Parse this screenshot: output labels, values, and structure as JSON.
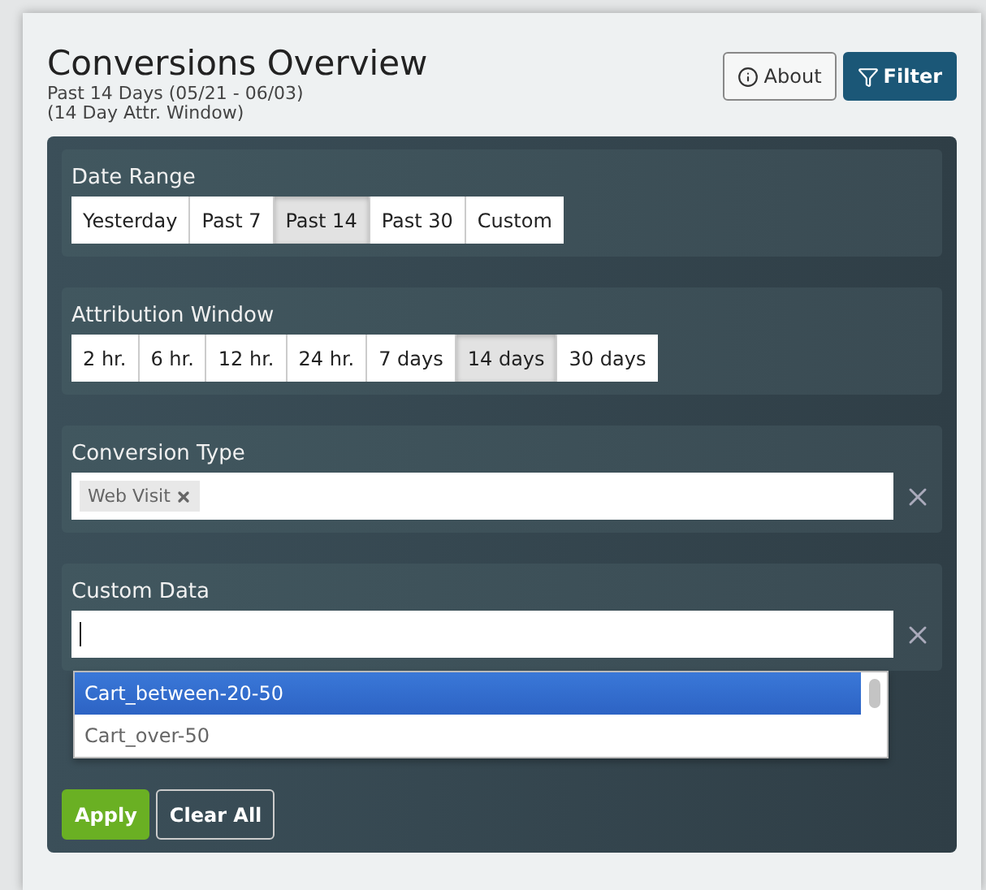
{
  "header": {
    "title": "Conversions Overview",
    "subtitle_lines": [
      "Past 14 Days (05/21 - 06/03)",
      "(14 Day Attr. Window)"
    ],
    "buttons": [
      {
        "label": "About",
        "kind": "info"
      },
      {
        "label": "Filter",
        "kind": "filter"
      }
    ]
  },
  "date_range": {
    "label": "Date Range",
    "options": [
      {
        "label": "Yesterday",
        "selected": false
      },
      {
        "label": "Past 7",
        "selected": false
      },
      {
        "label": "Past 14",
        "selected": true
      },
      {
        "label": "Past 30",
        "selected": false
      },
      {
        "label": "Custom",
        "selected": false
      }
    ]
  },
  "attribution_window": {
    "label": "Attribution Window",
    "options": [
      {
        "label": "2 hr.",
        "selected": false
      },
      {
        "label": "6 hr.",
        "selected": false
      },
      {
        "label": "12 hr.",
        "selected": false
      },
      {
        "label": "24 hr.",
        "selected": false
      },
      {
        "label": "7 days",
        "selected": false
      },
      {
        "label": "14 days",
        "selected": true
      },
      {
        "label": "30 days",
        "selected": false
      }
    ]
  },
  "conversion_type": {
    "label": "Conversion Type",
    "tags": [
      "Web Visit"
    ]
  },
  "custom_data": {
    "label": "Custom Data",
    "dropdown": [
      {
        "label": "Cart_between-20-50",
        "selected": true
      },
      {
        "label": "Cart_over-50",
        "selected": false
      }
    ]
  },
  "actions": [
    {
      "label": "Apply",
      "kind": "primary"
    },
    {
      "label": "Clear All",
      "kind": "outline"
    }
  ]
}
